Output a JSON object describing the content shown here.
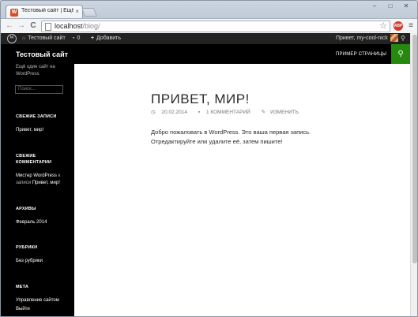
{
  "browser": {
    "tab_title": "Тестовый сайт | Ещё одни",
    "tab_favicon": "W",
    "tab_close": "×",
    "url_host": "localhost",
    "url_path": "/blog/",
    "back_glyph": "←",
    "forward_glyph": "→",
    "reload_glyph": "C",
    "star_glyph": "☆",
    "ext_badge": "ABP",
    "menu_glyph": "≡",
    "min_glyph": "–",
    "max_glyph": "□",
    "close_glyph": "✕"
  },
  "adminbar": {
    "wp_logo": "W",
    "site_name": "Тестовый сайт",
    "comments_count": "0",
    "add_new": "Добавить",
    "greeting": "Привет, my-cool-nick",
    "search_glyph": "⚲"
  },
  "site": {
    "title": "Тестовый сайт",
    "nav_item": "ПРИМЕР СТРАНИЦЫ",
    "search_glyph": "⚲"
  },
  "sidebar": {
    "description": "Ещё один сайт на WordPress",
    "search_placeholder": "Поиск...",
    "recent_posts_heading": "СВЕЖИЕ ЗАПИСИ",
    "recent_post": "Привет, мир!",
    "recent_comments_heading": "СВЕЖИЕ КОММЕНТАРИИ",
    "comment_author": "Мистер WordPress",
    "comment_on": " к записи ",
    "comment_post": "Привет, мир!",
    "archives_heading": "АРХИВЫ",
    "archive_item": "Февраль 2014",
    "categories_heading": "РУБРИКИ",
    "category_item": "Без рубрики",
    "meta_heading": "МЕТА",
    "meta_admin": "Управление сайтом",
    "meta_logout": "Выйти"
  },
  "post": {
    "title": "ПРИВЕТ, МИР!",
    "date": "20.02.2014",
    "comments": "1 КОММЕНТАРИЙ",
    "edit": "ИЗМЕНИТЬ",
    "content": "Добро пожаловать в WordPress. Это ваша первая запись. Отредактируйте или удалите её, затем пишите!"
  }
}
